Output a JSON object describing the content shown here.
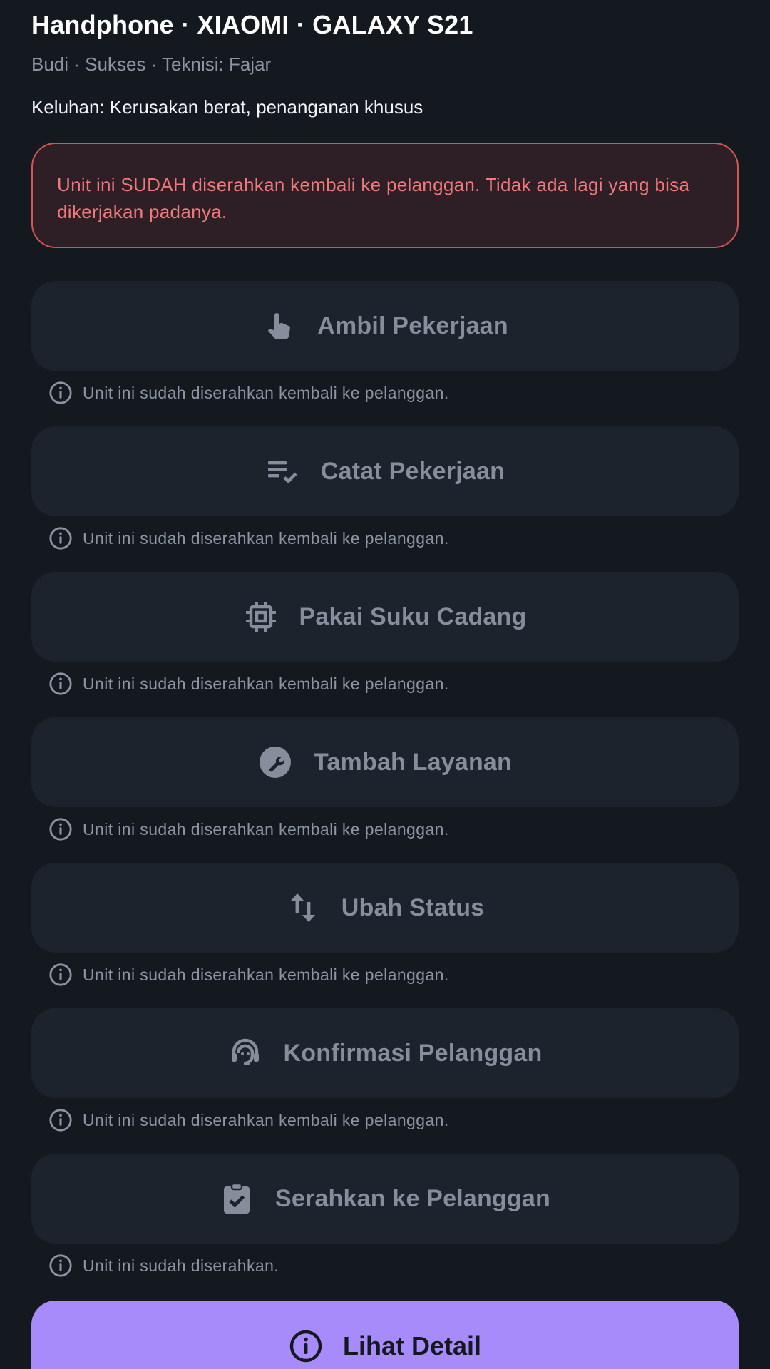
{
  "header": {
    "title": "Handphone  · XIAOMI · GALAXY S21",
    "subtitle": "Budi · Sukses · Teknisi: Fajar",
    "complaint": "Keluhan: Kerusakan berat, penanganan khusus"
  },
  "alert": {
    "message": "Unit ini SUDAH diserahkan kembali ke pelanggan. Tidak ada lagi yang bisa dikerjakan padanya."
  },
  "actions": [
    {
      "label": "Ambil Pekerjaan",
      "icon": "touch-hand-icon",
      "hint": "Unit ini sudah diserahkan kembali ke pelanggan."
    },
    {
      "label": "Catat Pekerjaan",
      "icon": "checklist-icon",
      "hint": "Unit ini sudah diserahkan kembali ke pelanggan."
    },
    {
      "label": "Pakai Suku Cadang",
      "icon": "chip-icon",
      "hint": "Unit ini sudah diserahkan kembali ke pelanggan."
    },
    {
      "label": "Tambah Layanan",
      "icon": "wrench-icon",
      "hint": "Unit ini sudah diserahkan kembali ke pelanggan."
    },
    {
      "label": "Ubah Status",
      "icon": "swap-vertical-icon",
      "hint": "Unit ini sudah diserahkan kembali ke pelanggan."
    },
    {
      "label": "Konfirmasi Pelanggan",
      "icon": "support-agent-icon",
      "hint": "Unit ini sudah diserahkan kembali ke pelanggan."
    },
    {
      "label": "Serahkan ke Pelanggan",
      "icon": "clipboard-check-icon",
      "hint": "Unit ini sudah diserahkan."
    }
  ],
  "primary": {
    "label": "Lihat Detail",
    "icon": "info-icon"
  },
  "colors": {
    "background": "#141920",
    "alert_border": "#d55454",
    "alert_text": "#f0787a",
    "disabled_button": "#1c232d",
    "primary_button": "#a78bfa"
  }
}
